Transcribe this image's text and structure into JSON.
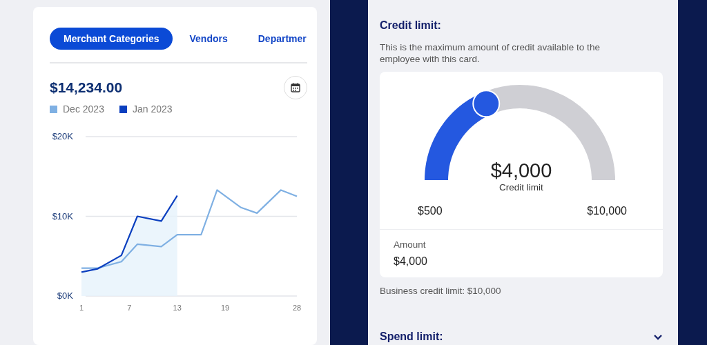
{
  "tabs": [
    {
      "label": "Merchant Categories",
      "selected": true
    },
    {
      "label": "Vendors",
      "selected": false
    },
    {
      "label": "Departmer",
      "selected": false
    }
  ],
  "total": "$14,234.00",
  "chart_data": {
    "type": "line",
    "x": [
      1,
      3,
      6,
      8,
      11,
      13,
      16,
      18,
      21,
      23,
      26,
      28
    ],
    "xticks": [
      1,
      7,
      13,
      19,
      28
    ],
    "xlim": [
      1,
      28
    ],
    "ylim": [
      0,
      20
    ],
    "yticks": [
      {
        "value": 0,
        "label": "$0K"
      },
      {
        "value": 10,
        "label": "$10K"
      },
      {
        "value": 20,
        "label": "$20K"
      }
    ],
    "series": [
      {
        "name": "Dec 2023",
        "color": "#7fb0e3",
        "values": [
          3.5,
          3.5,
          4.3,
          6.5,
          6.2,
          7.7,
          7.7,
          13.3,
          11.1,
          10.4,
          13.3,
          12.5
        ]
      },
      {
        "name": "Jan 2023",
        "color": "#0b3fbf",
        "values": [
          3.0,
          3.4,
          5.1,
          10.0,
          9.4,
          12.6,
          null,
          null,
          null,
          null,
          null,
          null
        ]
      }
    ]
  },
  "credit": {
    "title": "Credit limit:",
    "description": "This is the maximum amount of credit available to the employee with this card.",
    "value": "$4,000",
    "value_label": "Credit limit",
    "min": "$500",
    "max": "$10,000",
    "amount_label": "Amount",
    "amount": "$4,000",
    "business_limit": "Business credit limit: $10,000"
  },
  "spend": {
    "title": "Spend limit:",
    "expanded": false
  }
}
